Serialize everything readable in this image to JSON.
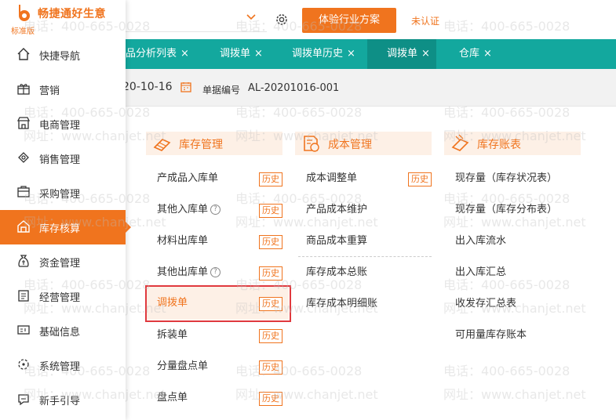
{
  "brand": {
    "name": "畅捷通好生意",
    "edition": "标准版"
  },
  "header": {
    "trial_button": "体验行业方案",
    "status": "未认证"
  },
  "tabs": [
    {
      "label": "品分析列表"
    },
    {
      "label": "调拨单"
    },
    {
      "label": "调拨单历史"
    },
    {
      "label": "调拨单"
    },
    {
      "label": "仓库"
    }
  ],
  "tab_close": "×",
  "toolbar": {
    "date": "20-10-16",
    "doc_label": "单据编号",
    "doc_value": "AL-20201016-001"
  },
  "sidebar": {
    "items": [
      {
        "label": "快捷导航",
        "icon": "home-icon"
      },
      {
        "label": "营销",
        "icon": "gift-icon"
      },
      {
        "label": "电商管理",
        "icon": "store-icon"
      },
      {
        "label": "销售管理",
        "icon": "sales-icon"
      },
      {
        "label": "采购管理",
        "icon": "purchase-icon"
      },
      {
        "label": "库存核算",
        "icon": "warehouse-icon"
      },
      {
        "label": "资金管理",
        "icon": "money-bag-icon"
      },
      {
        "label": "经营管理",
        "icon": "clipboard-icon"
      },
      {
        "label": "基础信息",
        "icon": "id-card-icon"
      },
      {
        "label": "系统管理",
        "icon": "system-icon"
      },
      {
        "label": "新手引导",
        "icon": "guide-icon"
      }
    ],
    "active_index": 5
  },
  "menu": {
    "history_label": "历史",
    "inventory": {
      "title": "库存管理",
      "items": [
        "产成品入库单",
        "其他入库单",
        "材料出库单",
        "其他出库单",
        "调拨单",
        "拆装单",
        "分量盘点单",
        "盘点单"
      ]
    },
    "cost": {
      "title": "成本管理",
      "items": [
        "成本调整单",
        "产品成本维护",
        "商品成本重算",
        "库存成本总账",
        "库存成本明细账"
      ]
    },
    "ledger": {
      "title": "库存账表",
      "items": [
        "现存量（库存状况表）",
        "现存量（库存分布表）",
        "出入库流水",
        "出入库汇总",
        "收发存汇总表",
        "可用量库存账本"
      ]
    }
  },
  "watermark": {
    "phone": "电话：400-665-0028",
    "site": "网址：www.chanjet.net"
  },
  "colors": {
    "accent": "#f0741e",
    "teal": "#13a89e",
    "teal_active": "#0e8f86",
    "highlight_border": "#e0393e"
  }
}
